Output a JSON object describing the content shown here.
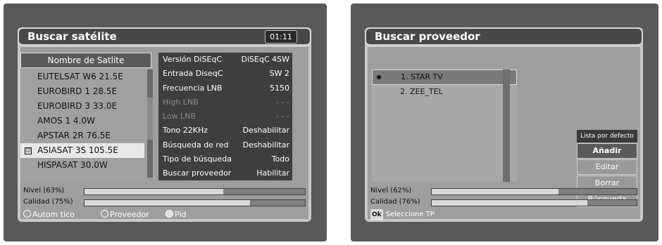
{
  "left": {
    "title": "Buscar satélite",
    "time": "01:11",
    "satellite_header": "Nombre de Satlite",
    "satellites": [
      {
        "name": "EUTELSAT W6 21.5E",
        "selected": false
      },
      {
        "name": "EUROBIRD 1 28.5E",
        "selected": false
      },
      {
        "name": "EUROBIRD 3 33.0E",
        "selected": false
      },
      {
        "name": "AMOS 1 4.0W",
        "selected": false
      },
      {
        "name": "APSTAR 2R 76.5E",
        "selected": false
      },
      {
        "name": "ASIASAT 3S 105.5E",
        "selected": true,
        "mark": "☑"
      },
      {
        "name": "HISPASAT 30.0W",
        "selected": false
      }
    ],
    "params": [
      {
        "label": "Versión DiSEqC",
        "value": "DiSEqC 4SW",
        "dim": false
      },
      {
        "label": "Entrada DiseqC",
        "value": "SW 2",
        "dim": false
      },
      {
        "label": "Frecuencia LNB",
        "value": "5150",
        "dim": false
      },
      {
        "label": "High LNB",
        "value": "- - -",
        "dim": true
      },
      {
        "label": "Low LNB",
        "value": "- - -",
        "dim": true
      },
      {
        "label": "Tono 22KHz",
        "value": "Deshabilitar",
        "dim": false
      },
      {
        "label": "Búsqueda de red",
        "value": "Deshabilitar",
        "dim": false
      },
      {
        "label": "Tipo de búsqueda",
        "value": "Todo",
        "dim": false
      },
      {
        "label": "Buscar proveedor",
        "value": "Habilitar",
        "dim": false
      }
    ],
    "level_label": "Nivel (63%)",
    "level_value": 0.63,
    "quality_label": "Calidad (75%)",
    "quality_value": 0.75,
    "legend": {
      "auto": "Autom tico",
      "provider": "Proveedor",
      "pid": "Pid"
    }
  },
  "right": {
    "title": "Buscar proveedor",
    "providers": [
      {
        "name": "1. STAR TV",
        "selected": true
      },
      {
        "name": "2. ZEE_TEL",
        "selected": false
      }
    ],
    "menu_title": "Lista por defecto",
    "menu_items": [
      "Añadir",
      "Editar",
      "Borrar",
      "Búsqueda"
    ],
    "menu_active_index": 0,
    "level_label": "Nivel (62%)",
    "level_value": 0.62,
    "quality_label": "Calidad (76%)",
    "quality_value": 0.76,
    "hint_badge": "Ok",
    "hint_text": "Seleccione TP"
  }
}
